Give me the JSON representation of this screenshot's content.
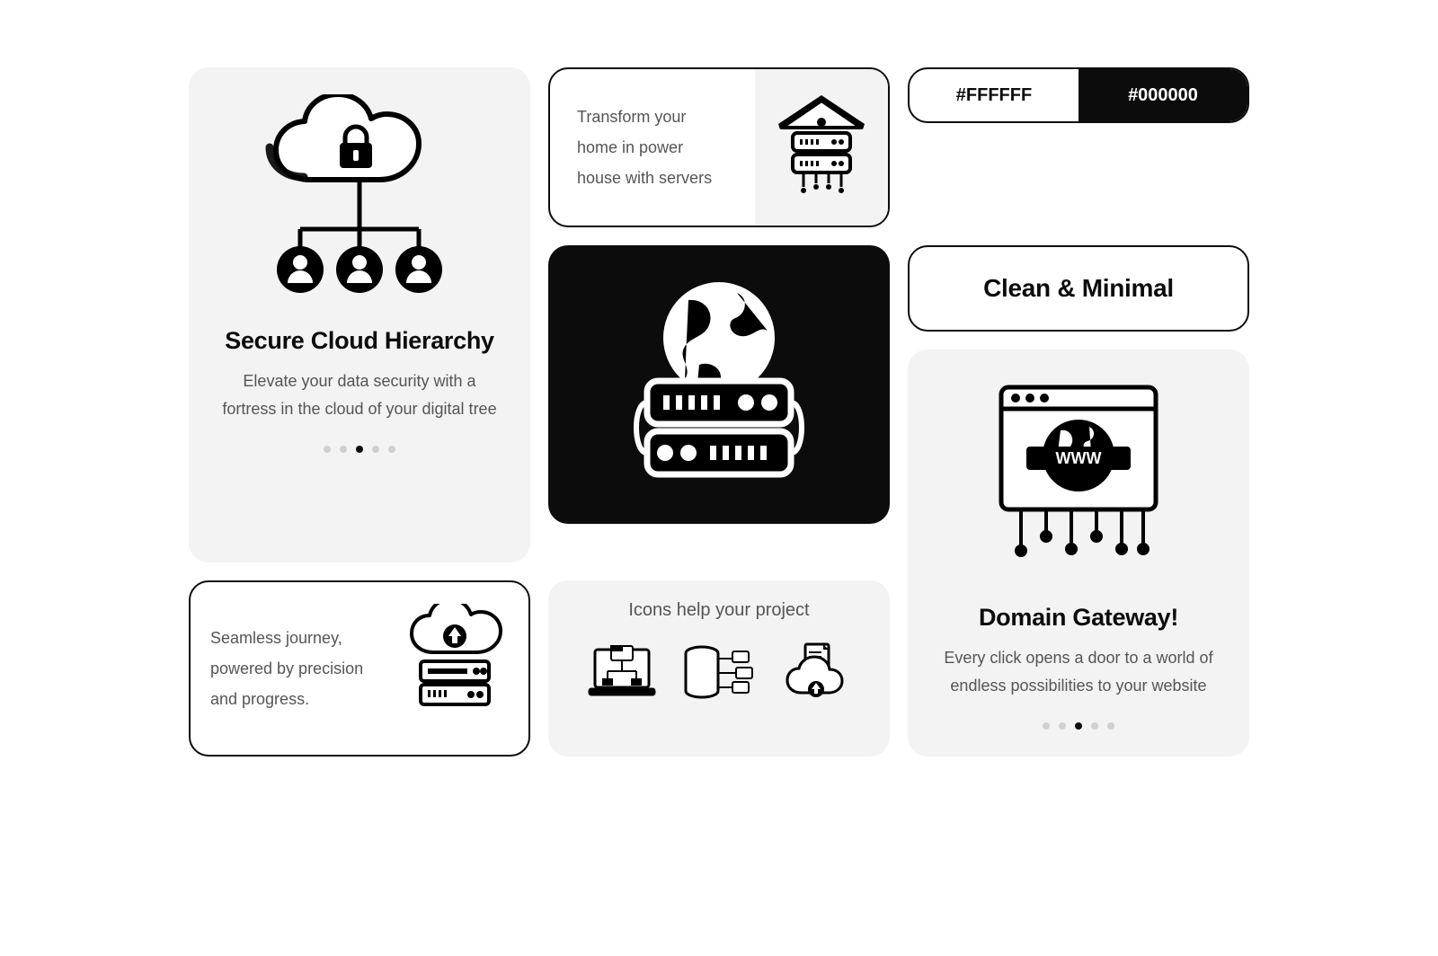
{
  "colors": {
    "light": "#FFFFFF",
    "dark": "#000000"
  },
  "cardA": {
    "title": "Secure Cloud Hierarchy",
    "desc": "Elevate your data security with a fortress in the cloud of your digital tree",
    "dots": {
      "count": 5,
      "active": 2
    },
    "icon": "cloud-lock-hierarchy-icon"
  },
  "cardB": {
    "text": "Transform your home in power house with servers",
    "icon": "home-server-icon"
  },
  "cardC": {
    "icon": "globe-server-icon"
  },
  "cardD": {
    "left": "#FFFFFF",
    "right": "#000000"
  },
  "cardE": {
    "text": "Clean & Minimal"
  },
  "cardF": {
    "title": "Domain Gateway!",
    "desc": "Every click opens a door to a world of endless possibilities to your website",
    "dots": {
      "count": 5,
      "active": 2
    },
    "icon": "browser-www-network-icon"
  },
  "cardG": {
    "text": "Seamless journey, powered by precision and progress.",
    "icon": "cloud-upload-server-icon"
  },
  "cardH": {
    "title": "Icons help your project",
    "icons": [
      "laptop-folder-icon",
      "database-folders-icon",
      "cloud-upload-doc-icon"
    ]
  }
}
